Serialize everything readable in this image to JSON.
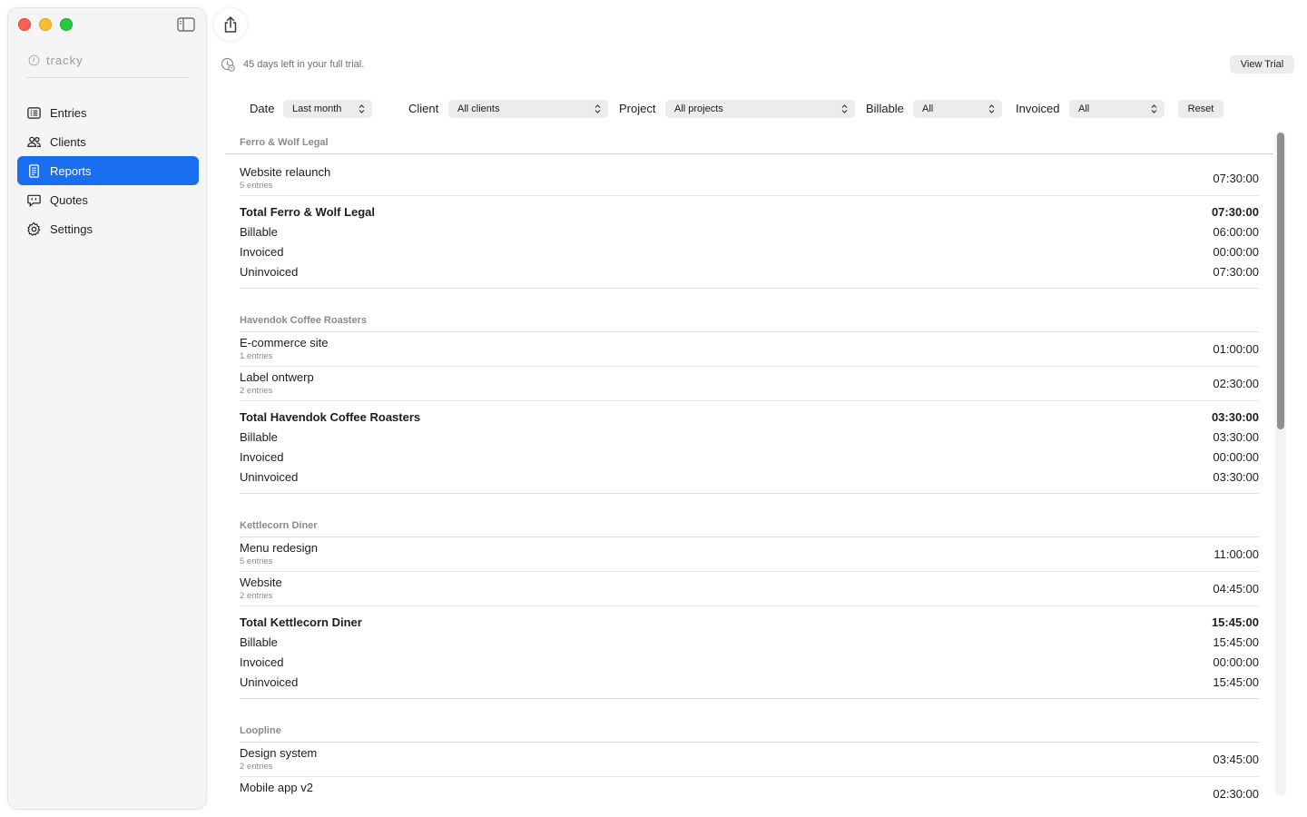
{
  "window": {
    "controls": [
      "close",
      "minimize",
      "zoom"
    ]
  },
  "sidebar": {
    "brand": "tracky",
    "items": [
      {
        "label": "Entries",
        "icon": "list-icon",
        "active": false
      },
      {
        "label": "Clients",
        "icon": "people-icon",
        "active": false
      },
      {
        "label": "Reports",
        "icon": "document-icon",
        "active": true
      },
      {
        "label": "Quotes",
        "icon": "speech-bubble-icon",
        "active": false
      },
      {
        "label": "Settings",
        "icon": "gear-icon",
        "active": false
      }
    ]
  },
  "toolbar": {
    "share_icon": "share-icon",
    "trial_text": "45 days left in your full trial.",
    "view_trial_label": "View Trial"
  },
  "filters": {
    "date_label": "Date",
    "date_value": "Last month",
    "client_label": "Client",
    "client_value": "All clients",
    "project_label": "Project",
    "project_value": "All projects",
    "billable_label": "Billable",
    "billable_value": "All",
    "invoiced_label": "Invoiced",
    "invoiced_value": "All",
    "reset_label": "Reset"
  },
  "report": {
    "clients": [
      {
        "name": "Ferro & Wolf Legal",
        "projects": [
          {
            "name": "Website relaunch",
            "entries": "5 entries",
            "time": "07:30:00"
          }
        ],
        "total_label": "Total Ferro & Wolf Legal",
        "total": "07:30:00",
        "billable_label": "Billable",
        "billable": "06:00:00",
        "invoiced_label": "Invoiced",
        "invoiced": "00:00:00",
        "uninvoiced_label": "Uninvoiced",
        "uninvoiced": "07:30:00"
      },
      {
        "name": "Havendok Coffee Roasters",
        "projects": [
          {
            "name": "E-commerce site",
            "entries": "1 entries",
            "time": "01:00:00"
          },
          {
            "name": "Label ontwerp",
            "entries": "2 entries",
            "time": "02:30:00"
          }
        ],
        "total_label": "Total Havendok Coffee Roasters",
        "total": "03:30:00",
        "billable_label": "Billable",
        "billable": "03:30:00",
        "invoiced_label": "Invoiced",
        "invoiced": "00:00:00",
        "uninvoiced_label": "Uninvoiced",
        "uninvoiced": "03:30:00"
      },
      {
        "name": "Kettlecorn Diner",
        "projects": [
          {
            "name": "Menu redesign",
            "entries": "5 entries",
            "time": "11:00:00"
          },
          {
            "name": "Website",
            "entries": "2 entries",
            "time": "04:45:00"
          }
        ],
        "total_label": "Total Kettlecorn Diner",
        "total": "15:45:00",
        "billable_label": "Billable",
        "billable": "15:45:00",
        "invoiced_label": "Invoiced",
        "invoiced": "00:00:00",
        "uninvoiced_label": "Uninvoiced",
        "uninvoiced": "15:45:00"
      },
      {
        "name": "Loopline",
        "projects": [
          {
            "name": "Design system",
            "entries": "2 entries",
            "time": "03:45:00"
          },
          {
            "name": "Mobile app v2",
            "entries": "",
            "time": "02:30:00"
          }
        ]
      }
    ]
  }
}
